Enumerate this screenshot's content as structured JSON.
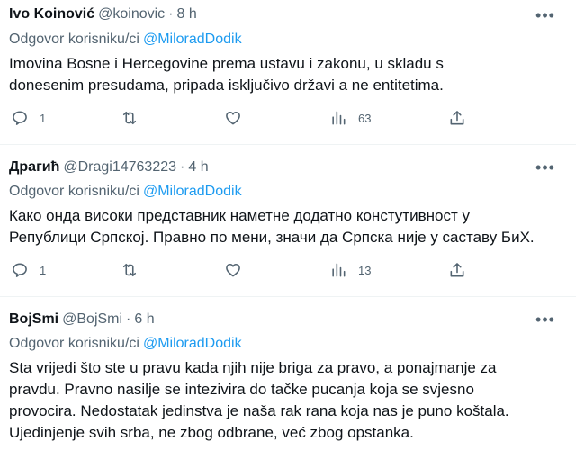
{
  "tweets": [
    {
      "author": "Ivo Koinović",
      "handle": "@koinovic",
      "separator": "·",
      "time": "8 h",
      "reply_prefix": "Odgovor korisniku/ci",
      "reply_to": "@MiloradDodik",
      "lines": [
        "Imovina Bosne i Hercegovine prema ustavu i zakonu, u skladu s",
        "donesenim presudama, pripada isključivo državi a ne entitetima."
      ],
      "replies": "1",
      "retweets": "",
      "likes": "",
      "views": "63"
    },
    {
      "author": "Драгић",
      "handle": "@Dragi14763223",
      "separator": "·",
      "time": "4 h",
      "reply_prefix": "Odgovor korisniku/ci",
      "reply_to": "@MiloradDodik",
      "lines": [
        "Како онда високи представник наметне додатно констутивност у",
        "Републици Српској. Правно по мени, значи да Српска није у саставу БиХ."
      ],
      "replies": "1",
      "retweets": "",
      "likes": "",
      "views": "13"
    },
    {
      "author": "BojSmi",
      "handle": "@BojSmi",
      "separator": "·",
      "time": "6 h",
      "reply_prefix": "Odgovor korisniku/ci",
      "reply_to": "@MiloradDodik",
      "lines": [
        "Sta vrijedi što ste u pravu kada njih nije briga za pravo, a ponajmanje za",
        "pravdu. Pravno nasilje se intezivira do tačke pucanja koja se svjesno",
        "provocira. Nedostatak jedinstva je naša rak rana koja nas je puno koštala.",
        "Ujedinjenje svih srba, ne zbog odbrane, već zbog opstanka."
      ]
    }
  ],
  "more_icon": "more-horizontal-icon",
  "colors": {
    "text": "#0f1419",
    "secondary": "#536471",
    "mention": "#1d9bf0",
    "divider": "#eff3f4"
  }
}
